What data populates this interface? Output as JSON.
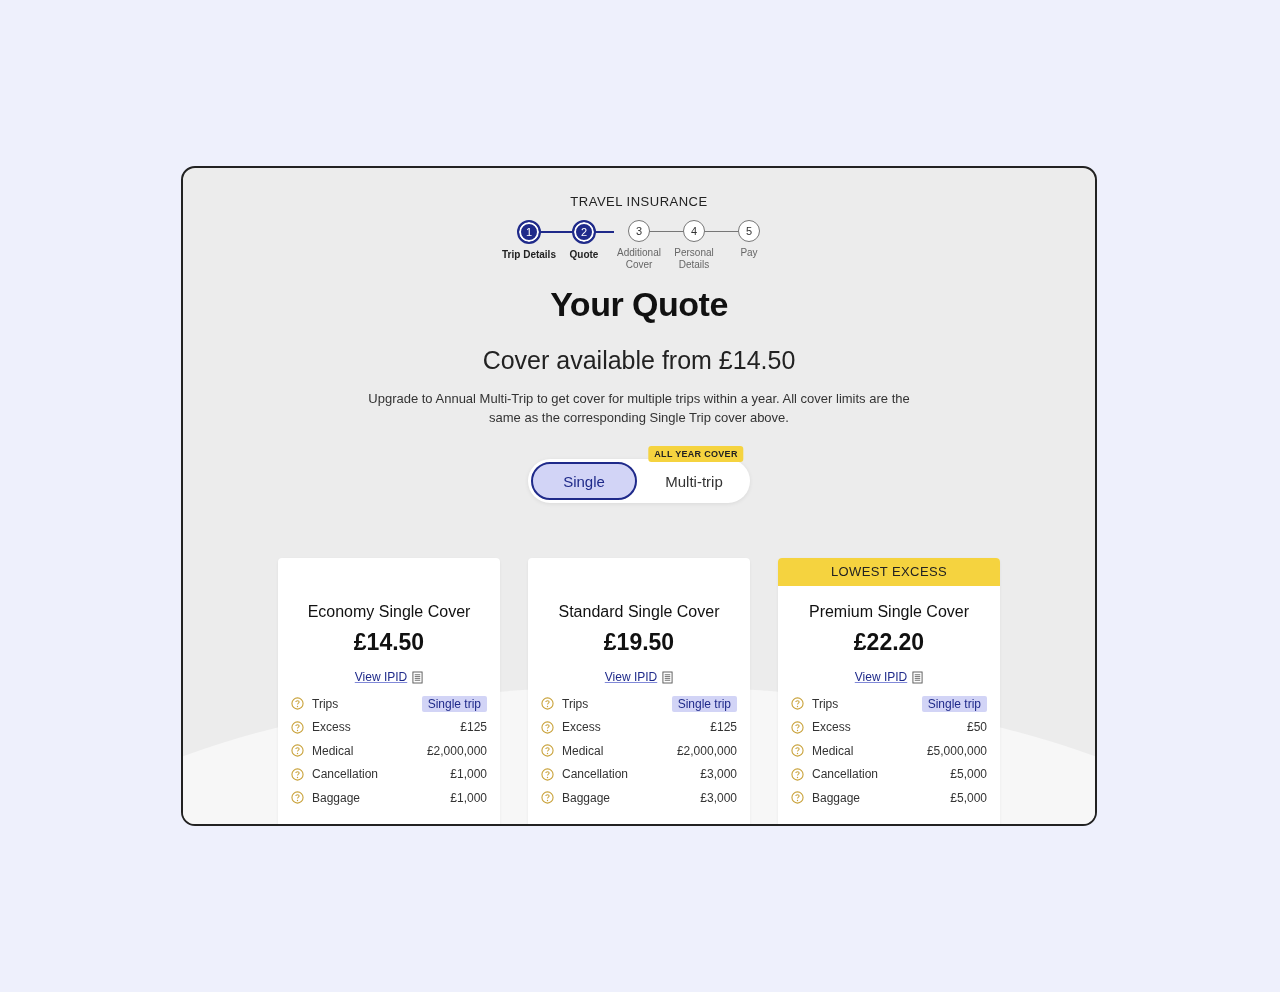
{
  "header": {
    "eyebrow": "TRAVEL INSURANCE"
  },
  "steps": [
    {
      "number": "1",
      "label": "Trip Details",
      "done": true
    },
    {
      "number": "2",
      "label": "Quote",
      "done": true
    },
    {
      "number": "3",
      "label": "Additional Cover",
      "done": false
    },
    {
      "number": "4",
      "label": "Personal Details",
      "done": false
    },
    {
      "number": "5",
      "label": "Pay",
      "done": false
    }
  ],
  "title": "Your Quote",
  "subtitle": "Cover available from £14.50",
  "description": "Upgrade to Annual Multi-Trip to get cover for multiple trips within a year. All cover limits are the same as the corresponding Single Trip cover above.",
  "trip_toggle": [
    {
      "label": "Single",
      "selected": true
    },
    {
      "label": "Multi-trip",
      "selected": false,
      "badge": "ALL YEAR COVER"
    }
  ],
  "plans": [
    {
      "name": "Economy Single Cover",
      "price": "£14.50",
      "link": "View IPID",
      "rows": [
        {
          "label": "Trips",
          "value": "Single trip",
          "kind": "tag"
        },
        {
          "label": "Excess",
          "value": "£125",
          "kind": "text"
        },
        {
          "label": "Medical",
          "value": "£2,000,000",
          "kind": "text"
        },
        {
          "label": "Cancellation",
          "value": "£1,000",
          "kind": "text"
        },
        {
          "label": "Baggage",
          "value": "£1,000",
          "kind": "text"
        }
      ]
    },
    {
      "name": "Standard Single Cover",
      "price": "£19.50",
      "link": "View IPID",
      "rows": [
        {
          "label": "Trips",
          "value": "Single trip",
          "kind": "tag"
        },
        {
          "label": "Excess",
          "value": "£125",
          "kind": "text"
        },
        {
          "label": "Medical",
          "value": "£2,000,000",
          "kind": "text"
        },
        {
          "label": "Cancellation",
          "value": "£3,000",
          "kind": "text"
        },
        {
          "label": "Baggage",
          "value": "£3,000",
          "kind": "text"
        }
      ]
    },
    {
      "banner": "LOWEST EXCESS",
      "name": "Premium Single Cover",
      "price": "£22.20",
      "link": "View IPID",
      "rows": [
        {
          "label": "Trips",
          "value": "Single trip",
          "kind": "tag"
        },
        {
          "label": "Excess",
          "value": "£50",
          "kind": "text"
        },
        {
          "label": "Medical",
          "value": "£5,000,000",
          "kind": "text"
        },
        {
          "label": "Cancellation",
          "value": "£5,000",
          "kind": "text"
        },
        {
          "label": "Baggage",
          "value": "£5,000",
          "kind": "text"
        }
      ]
    }
  ]
}
